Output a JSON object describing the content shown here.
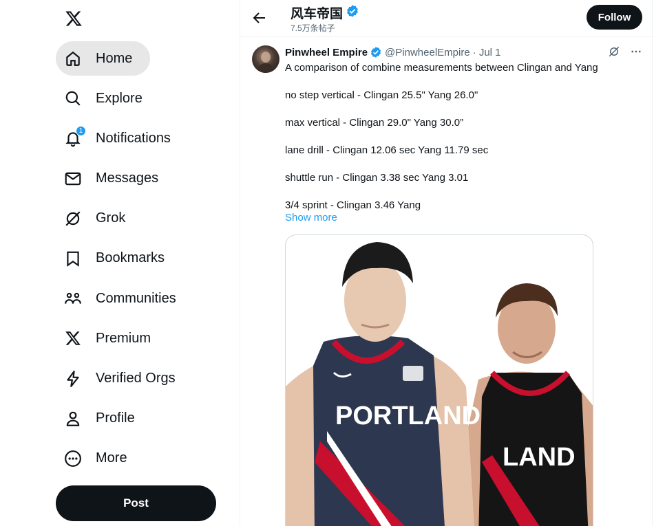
{
  "sidebar": {
    "items": [
      {
        "label": "Home",
        "icon": "home-icon",
        "active": true
      },
      {
        "label": "Explore",
        "icon": "search-icon"
      },
      {
        "label": "Notifications",
        "icon": "bell-icon",
        "badge": "1"
      },
      {
        "label": "Messages",
        "icon": "mail-icon"
      },
      {
        "label": "Grok",
        "icon": "grok-icon"
      },
      {
        "label": "Bookmarks",
        "icon": "bookmark-icon"
      },
      {
        "label": "Communities",
        "icon": "communities-icon"
      },
      {
        "label": "Premium",
        "icon": "x-logo-icon"
      },
      {
        "label": "Verified Orgs",
        "icon": "lightning-icon"
      },
      {
        "label": "Profile",
        "icon": "person-icon"
      },
      {
        "label": "More",
        "icon": "more-circle-icon"
      }
    ],
    "post_label": "Post"
  },
  "header": {
    "name": "风车帝国",
    "post_count": "7.5万条帖子",
    "follow_label": "Follow"
  },
  "tweet": {
    "author_name": "Pinwheel Empire",
    "handle": "@PinwheelEmpire",
    "date": "· Jul 1",
    "lines": [
      "A comparison of combine measurements between Clingan and Yang",
      "no step vertical - Clingan 25.5\"   Yang 26.0\"",
      "max vertical - Clingan 29.0\"   Yang 30.0”",
      "lane drill - Clingan 12.06 sec   Yang 11.79 sec",
      "shuttle run - Clingan 3.38 sec   Yang 3.01",
      "3/4 sprint -  Clingan 3.46   Yang"
    ],
    "show_more": "Show more",
    "media": {
      "jersey_left_text": "PORTLAND",
      "jersey_right_text": "LAND"
    }
  },
  "colors": {
    "accent": "#1d9bf0",
    "text": "#0f1419",
    "secondary": "#536471",
    "active_bg": "#e7e7e8"
  }
}
